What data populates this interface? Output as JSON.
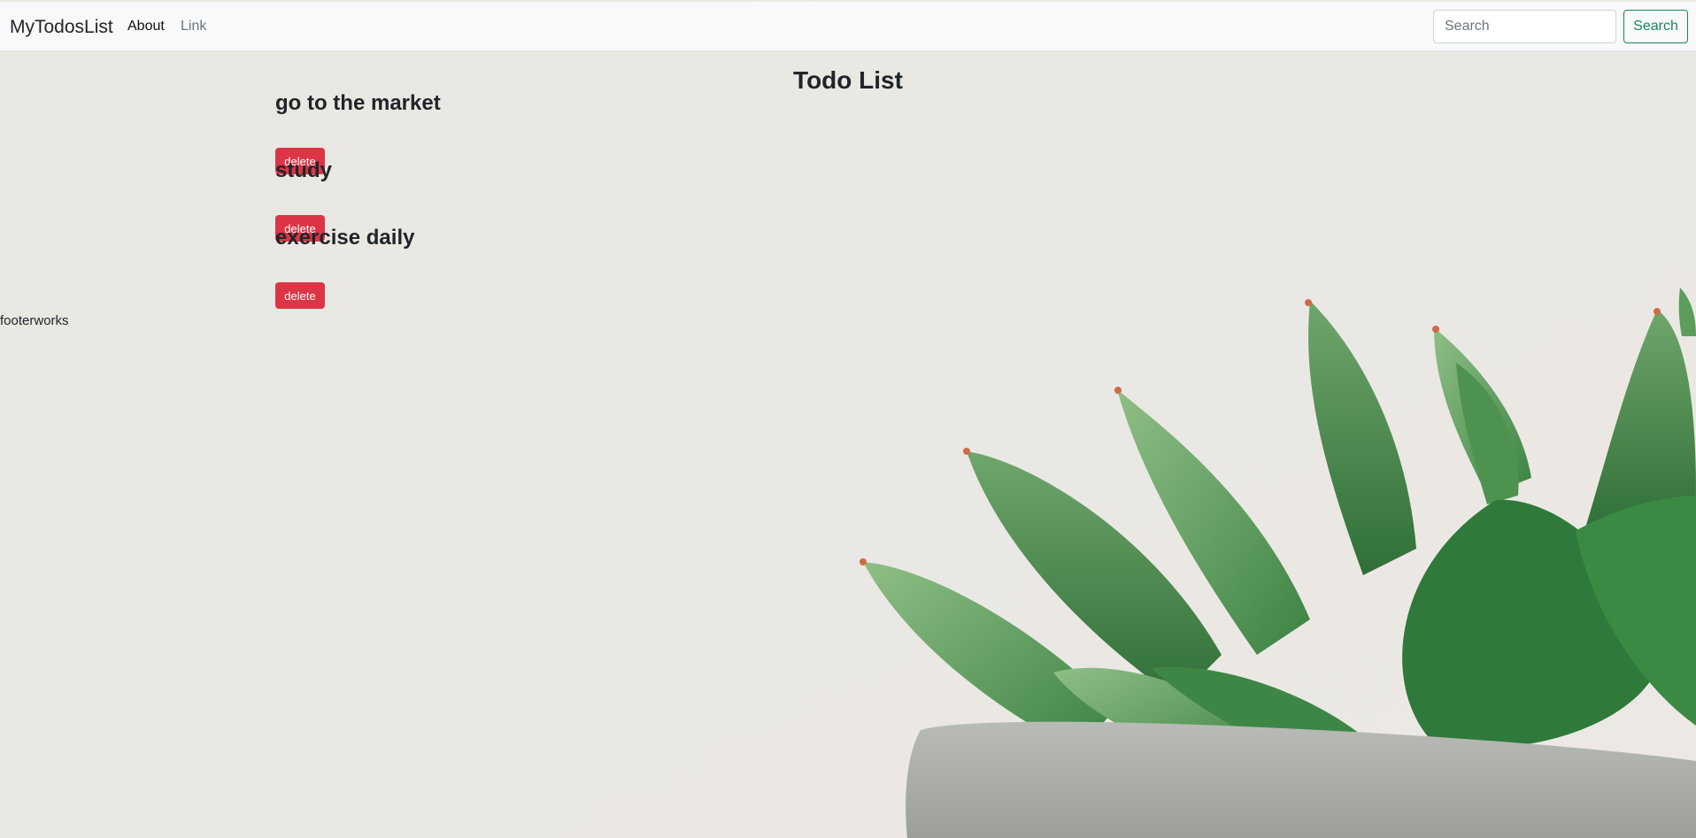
{
  "navbar": {
    "brand": "MyTodosList",
    "links": [
      "About",
      "Link"
    ],
    "search_placeholder": "Search",
    "search_button": "Search"
  },
  "main": {
    "title": "Todo List",
    "todos": [
      {
        "title": "go to the market",
        "delete_label": "delete"
      },
      {
        "title": "study",
        "delete_label": "delete"
      },
      {
        "title": "exercise daily",
        "delete_label": "delete"
      }
    ]
  },
  "footer": {
    "text": "footerworks"
  },
  "colors": {
    "background": "#e9e8e3",
    "navbar": "#f8f9fa",
    "danger": "#dc3545",
    "success": "#198754",
    "plant_green": "#3f8a48",
    "pot_gray": "#a9aba7"
  }
}
